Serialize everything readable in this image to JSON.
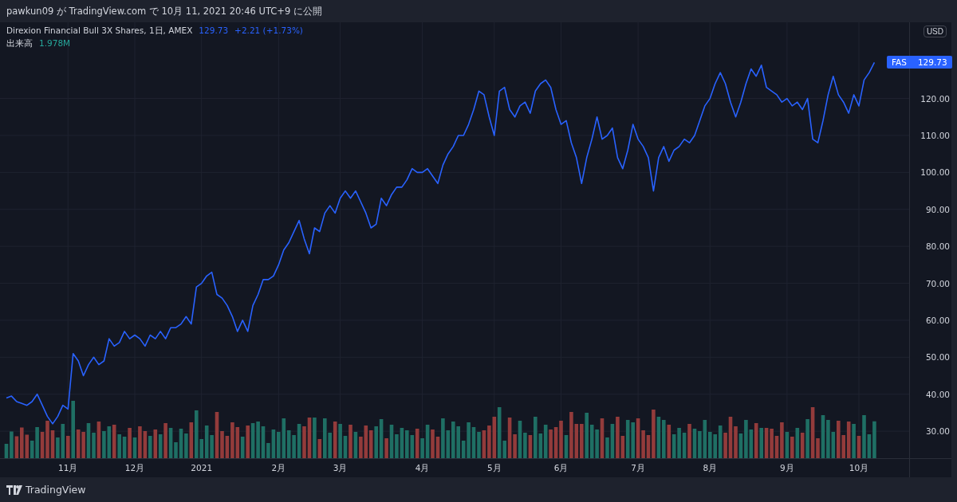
{
  "header": {
    "text": "pawkun09 が TradingView.com で 10月 11, 2021 20:46 UTC+9 に公開"
  },
  "legend": {
    "title": "Direxion Financial Bull 3X Shares, 1日, AMEX",
    "price": "129.73",
    "change": "+2.21 (+1.73%)",
    "volume_label": "出来高",
    "volume_value": "1.978M"
  },
  "currency_button": "USD",
  "price_label": {
    "price": "129.73"
  },
  "chart_data": {
    "type": "line",
    "categories": [
      null,
      null,
      null,
      null,
      null,
      null,
      null,
      null,
      null,
      null,
      null,
      null,
      "11月",
      null,
      null,
      null,
      null,
      null,
      null,
      null,
      null,
      null,
      null,
      null,
      null,
      "12月",
      null,
      null,
      null,
      null,
      null,
      null,
      null,
      null,
      null,
      null,
      null,
      null,
      "2021",
      null,
      null,
      null,
      null,
      null,
      null,
      null,
      null,
      null,
      null,
      null,
      null,
      null,
      null,
      "2月",
      null,
      null,
      null,
      null,
      null,
      null,
      null,
      null,
      null,
      null,
      null,
      "3月",
      null,
      null,
      null,
      null,
      null,
      null,
      null,
      null,
      null,
      null,
      null,
      null,
      null,
      null,
      null,
      "4月",
      null,
      null,
      null,
      null,
      null,
      null,
      null,
      null,
      null,
      null,
      null,
      null,
      null,
      "5月",
      null,
      null,
      null,
      null,
      null,
      null,
      null,
      null,
      null,
      null,
      null,
      null,
      "6月",
      null,
      null,
      null,
      null,
      null,
      null,
      null,
      null,
      null,
      null,
      null,
      null,
      null,
      null,
      "7月",
      null,
      null,
      null,
      null,
      null,
      null,
      null,
      null,
      null,
      null,
      null,
      null,
      null,
      "8月",
      null,
      null,
      null,
      null,
      null,
      null,
      null,
      null,
      null,
      null,
      null,
      null,
      null,
      null,
      "9月",
      null,
      null,
      null,
      null,
      null,
      null,
      null,
      null,
      null,
      null,
      null,
      null,
      null,
      "10月",
      null,
      null,
      null
    ],
    "series": [
      {
        "name": "FAS",
        "color": "#2962ff",
        "values": [
          39,
          39.5,
          38,
          37.5,
          37,
          38,
          40,
          37,
          34,
          32,
          34,
          37,
          36,
          51,
          49,
          45,
          48,
          50,
          48,
          49,
          55,
          53,
          54,
          57,
          55,
          56,
          55,
          53,
          56,
          55,
          57,
          55,
          58,
          58,
          59,
          61,
          59,
          69,
          70,
          72,
          73,
          67,
          66,
          64,
          61,
          57,
          60,
          57,
          64,
          67,
          71,
          71,
          72,
          75,
          79,
          81,
          84,
          87,
          82,
          78,
          85,
          84,
          89,
          91,
          89,
          93,
          95,
          93,
          95,
          92,
          89,
          85,
          86,
          93,
          91,
          94,
          96,
          96,
          98,
          101,
          100,
          100,
          101,
          99,
          97,
          102,
          105,
          107,
          110,
          110,
          113,
          117,
          122,
          121,
          115,
          110,
          122,
          123,
          117,
          115,
          118,
          119,
          116,
          122,
          124,
          125,
          123,
          117,
          113,
          114,
          108,
          104,
          97,
          104,
          109,
          115,
          109,
          110,
          112,
          104,
          101,
          106,
          113,
          109,
          107,
          104,
          95,
          104,
          107,
          103,
          106,
          107,
          109,
          108,
          110,
          114,
          118,
          120,
          124,
          127,
          124,
          119,
          115,
          119,
          124,
          128,
          126,
          129,
          123,
          122,
          121,
          119,
          120,
          118,
          119,
          117,
          120,
          109,
          108,
          114,
          121,
          126,
          121,
          119,
          116,
          121,
          118,
          125,
          127,
          129.73
        ]
      }
    ],
    "ylim": [
      22.7,
      140.6
    ],
    "grid": true,
    "yticks": [
      {
        "value": 30,
        "label": "30.00"
      },
      {
        "value": 40,
        "label": "40.00"
      },
      {
        "value": 50,
        "label": "50.00"
      },
      {
        "value": 60,
        "label": "60.00"
      },
      {
        "value": 70,
        "label": "70.00"
      },
      {
        "value": 80,
        "label": "80.00"
      },
      {
        "value": 90,
        "label": "90.00"
      },
      {
        "value": 100,
        "label": "100.00"
      },
      {
        "value": 110,
        "label": "110.00"
      },
      {
        "value": 120,
        "label": "120.00"
      }
    ]
  },
  "footer": {
    "logo_text": "TradingView"
  }
}
